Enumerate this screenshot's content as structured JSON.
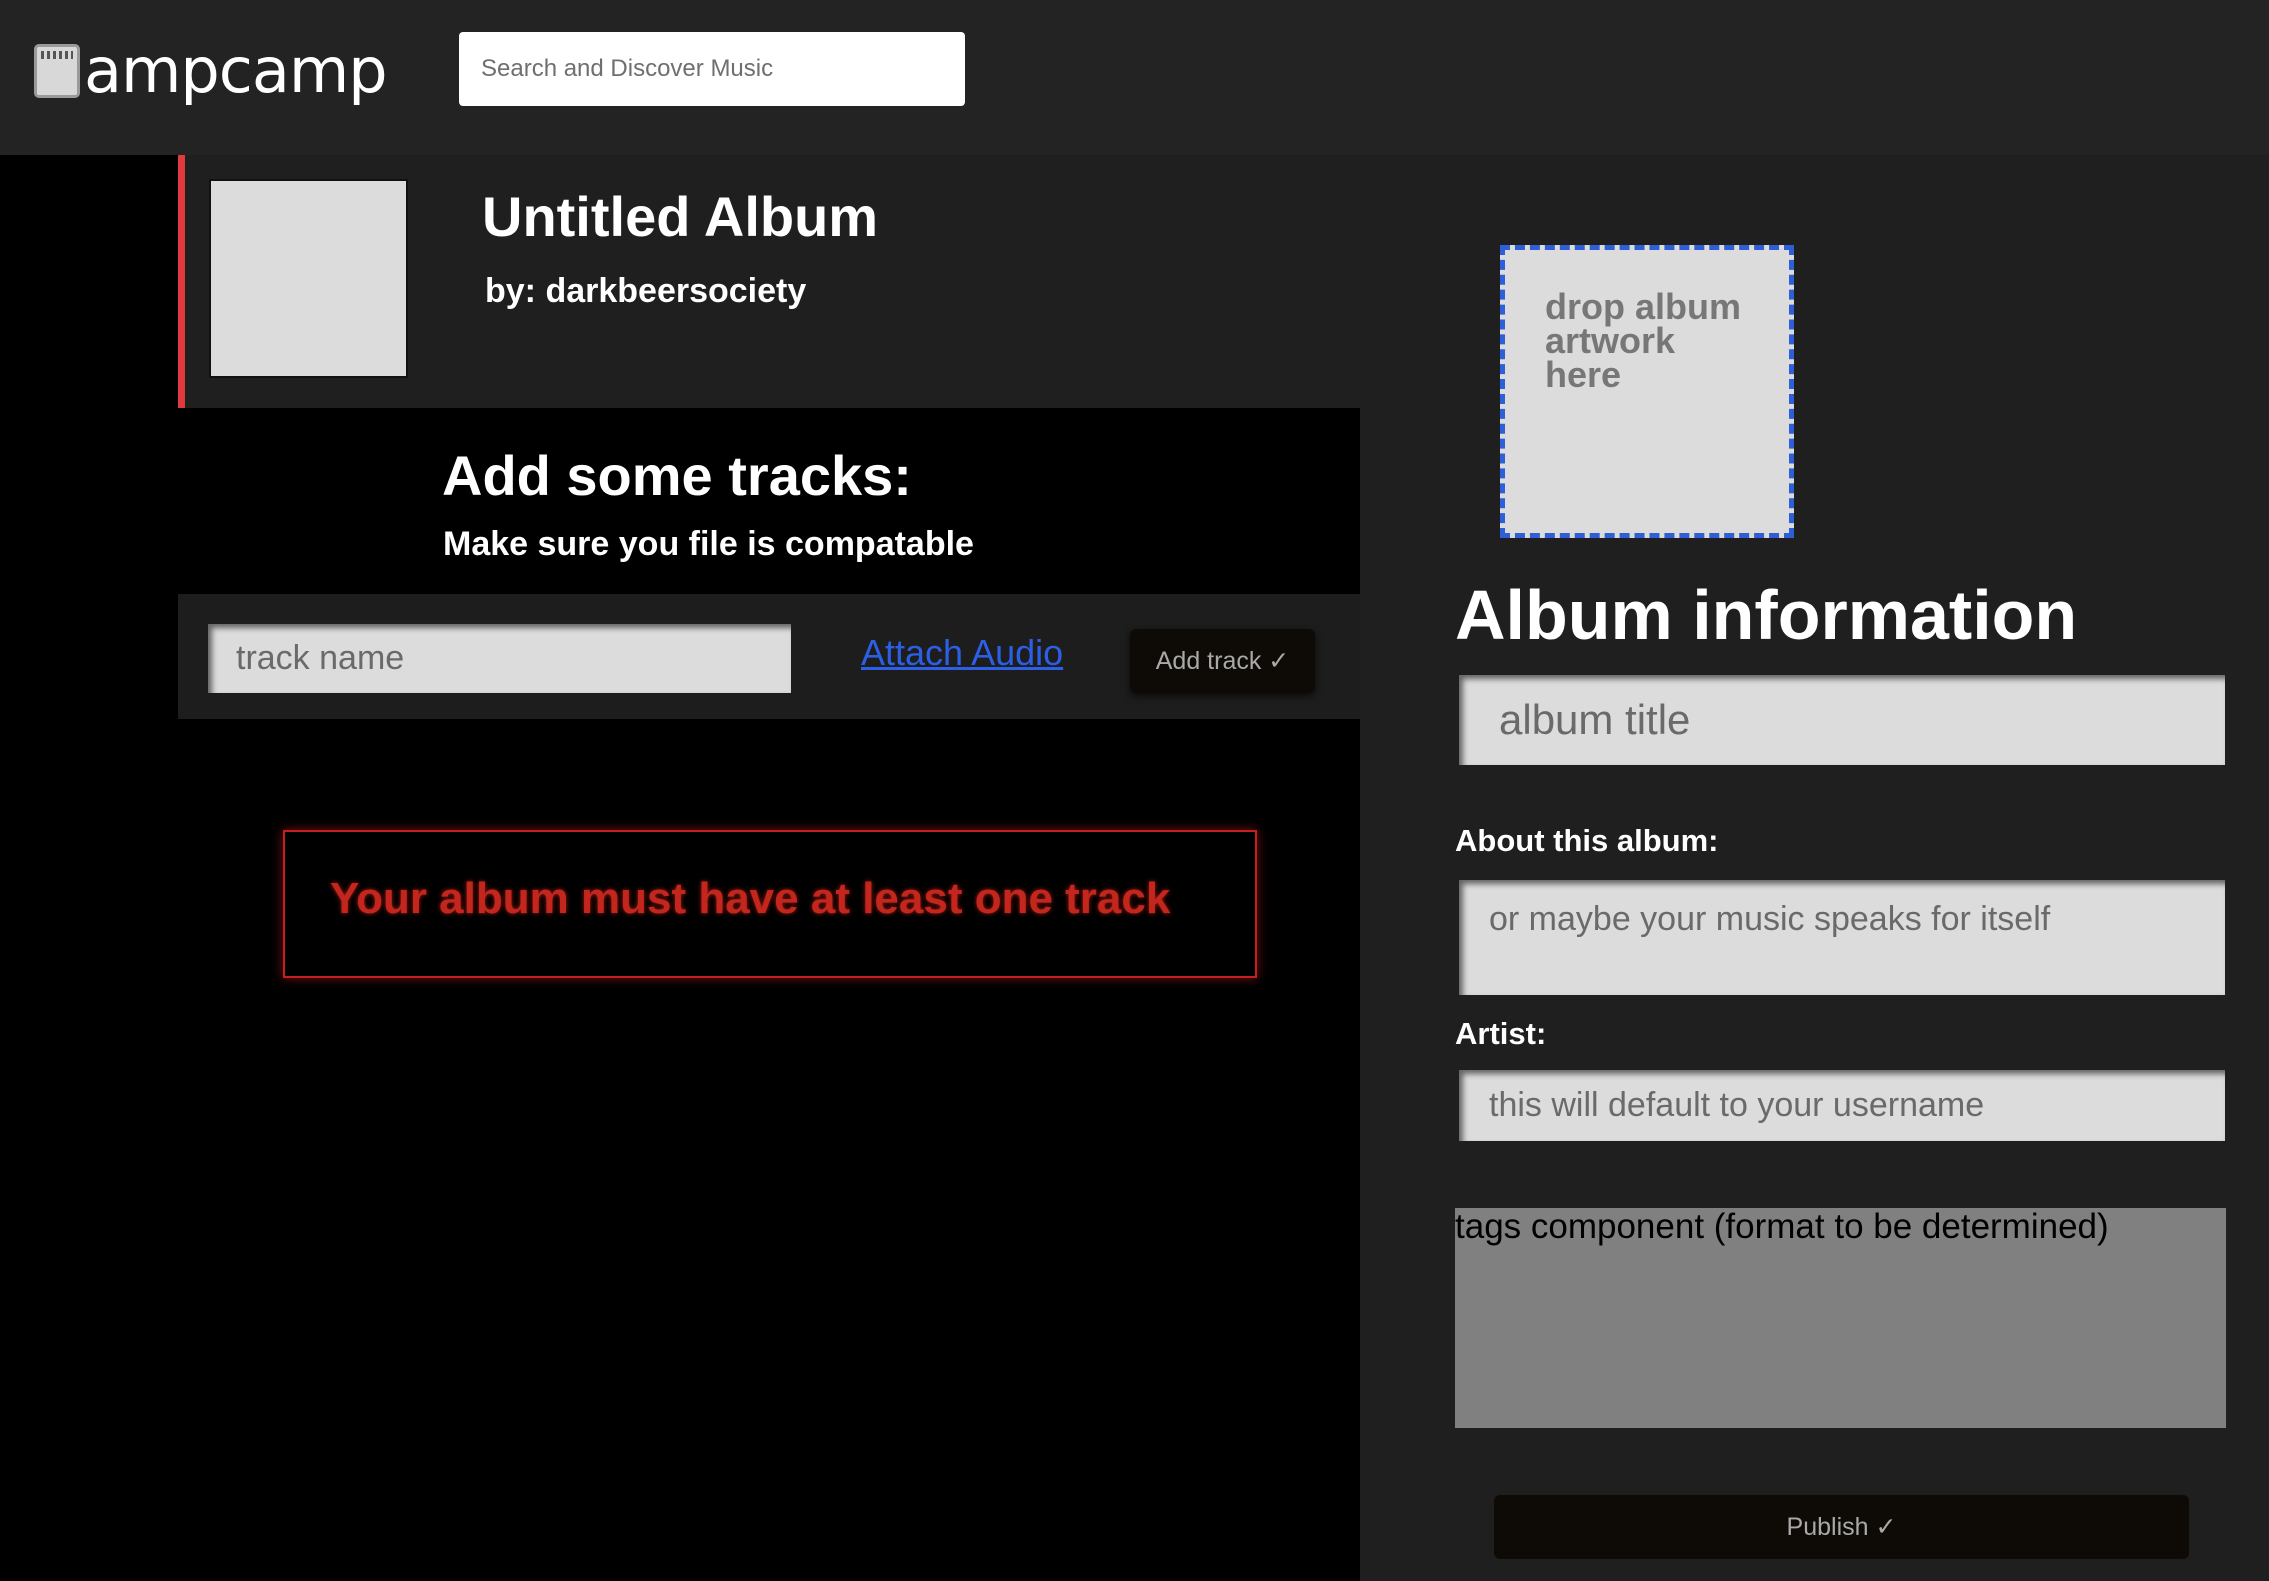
{
  "header": {
    "logo_text": "ampcamp",
    "search_placeholder": "Search and Discover Music"
  },
  "album": {
    "title": "Untitled Album",
    "by": "by: darkbeersociety"
  },
  "tracks": {
    "heading": "Add some tracks:",
    "subheading": "Make sure you file is compatable",
    "track_name_placeholder": "track name",
    "attach_audio_label": "Attach Audio",
    "add_track_label": "Add track ✓",
    "error_message": "Your album must have at least one track"
  },
  "album_info": {
    "dropzone_text": "drop album artwork here",
    "heading": "Album information",
    "title_placeholder": "album title",
    "about_label": "About this album:",
    "about_placeholder": "or maybe your music speaks for itself",
    "artist_label": "Artist:",
    "artist_placeholder": "this will default to your username",
    "tags_text": "tags component (format to be determined)",
    "publish_label": "Publish ✓"
  },
  "colors": {
    "accent_red": "#e0393e",
    "error_red": "#c3261c",
    "link_blue": "#2c5fe6",
    "dropzone_border": "#2f5fd6"
  }
}
